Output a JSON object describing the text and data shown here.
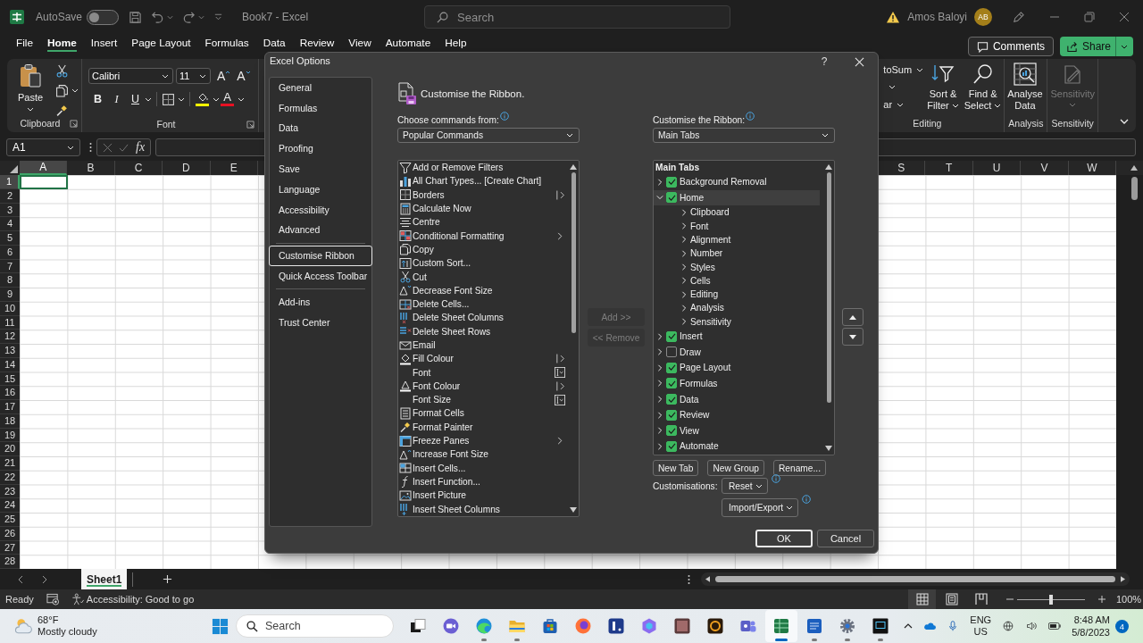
{
  "titlebar": {
    "autosave": {
      "label": "AutoSave",
      "on": false
    },
    "title": "Book7 - Excel",
    "search": {
      "placeholder": "Search"
    },
    "user": "Amos Baloyi",
    "avatar": "AB"
  },
  "menu_tabs": [
    {
      "label": "File",
      "selected": false
    },
    {
      "label": "Home",
      "selected": true
    },
    {
      "label": "Insert",
      "selected": false
    },
    {
      "label": "Page Layout",
      "selected": false
    },
    {
      "label": "Formulas",
      "selected": false
    },
    {
      "label": "Data",
      "selected": false
    },
    {
      "label": "Review",
      "selected": false
    },
    {
      "label": "View",
      "selected": false
    },
    {
      "label": "Automate",
      "selected": false
    },
    {
      "label": "Help",
      "selected": false
    }
  ],
  "header_buttons": {
    "comments": "Comments",
    "share": "Share"
  },
  "ribbon": {
    "clipboard": {
      "paste": "Paste",
      "label": "Clipboard"
    },
    "font": {
      "name": "Calibri",
      "size": "11",
      "label": "Font",
      "size_buttons": [
        {
          "kind": "grow",
          "label": "A"
        },
        {
          "kind": "shrink",
          "label": "A"
        }
      ],
      "style_buttons": [
        {
          "kind": "bold",
          "label": "B"
        },
        {
          "kind": "italic",
          "label": "I"
        },
        {
          "kind": "underline",
          "label": "U"
        }
      ],
      "color_buttons": [
        {
          "kind": "fill",
          "color": "#ffff00"
        },
        {
          "kind": "font",
          "label": "A",
          "color": "#e81123"
        }
      ]
    },
    "editing": {
      "cut_labels": [
        "toSum",
        "ar"
      ],
      "label": "Editing",
      "buttons": [
        {
          "kind": "sort",
          "lines": [
            "Sort &",
            "Filter"
          ],
          "disabled": false
        },
        {
          "kind": "find",
          "lines": [
            "Find &",
            "Select"
          ],
          "disabled": false
        }
      ]
    },
    "analysis": {
      "label": "Analysis",
      "buttons": [
        {
          "kind": "analyse",
          "lines": [
            "Analyse",
            "Data"
          ],
          "disabled": false
        }
      ]
    },
    "sensitivity": {
      "label": "Sensitivity",
      "buttons": [
        {
          "kind": "sensitivity",
          "lines": [
            "Sensitivity"
          ],
          "disabled": true
        }
      ]
    }
  },
  "formula_bar": {
    "name_box": "A1",
    "fx": "fx"
  },
  "sheet": {
    "columns_left": [
      {
        "label": "A",
        "selected": true
      },
      {
        "label": "B",
        "selected": false
      },
      {
        "label": "C",
        "selected": false
      },
      {
        "label": "D",
        "selected": false
      },
      {
        "label": "E",
        "selected": false
      }
    ],
    "columns_right": [
      {
        "label": "S",
        "selected": false
      },
      {
        "label": "T",
        "selected": false
      },
      {
        "label": "U",
        "selected": false
      },
      {
        "label": "V",
        "selected": false
      },
      {
        "label": "W",
        "selected": false
      }
    ],
    "rows": [
      {
        "label": "1",
        "selected": true
      },
      {
        "label": "2",
        "selected": false
      },
      {
        "label": "3",
        "selected": false
      },
      {
        "label": "4",
        "selected": false
      },
      {
        "label": "5",
        "selected": false
      },
      {
        "label": "6",
        "selected": false
      },
      {
        "label": "7",
        "selected": false
      },
      {
        "label": "8",
        "selected": false
      },
      {
        "label": "9",
        "selected": false
      },
      {
        "label": "10",
        "selected": false
      },
      {
        "label": "11",
        "selected": false
      },
      {
        "label": "12",
        "selected": false
      },
      {
        "label": "13",
        "selected": false
      },
      {
        "label": "14",
        "selected": false
      },
      {
        "label": "15",
        "selected": false
      },
      {
        "label": "16",
        "selected": false
      },
      {
        "label": "17",
        "selected": false
      },
      {
        "label": "18",
        "selected": false
      },
      {
        "label": "19",
        "selected": false
      },
      {
        "label": "20",
        "selected": false
      },
      {
        "label": "21",
        "selected": false
      },
      {
        "label": "22",
        "selected": false
      },
      {
        "label": "23",
        "selected": false
      },
      {
        "label": "24",
        "selected": false
      },
      {
        "label": "25",
        "selected": false
      },
      {
        "label": "26",
        "selected": false
      },
      {
        "label": "27",
        "selected": false
      },
      {
        "label": "28",
        "selected": false
      }
    ]
  },
  "sheet_tabs": [
    {
      "label": "Sheet1",
      "selected": true
    }
  ],
  "status_bar": {
    "mode": "Ready",
    "accessibility": "Accessibility: Good to go",
    "views": [
      {
        "kind": "normal",
        "selected": true
      },
      {
        "kind": "layout",
        "selected": false
      },
      {
        "kind": "breaks",
        "selected": false
      }
    ],
    "zoom": {
      "level": 0.5,
      "reading": "100%"
    }
  },
  "dialog": {
    "title": "Excel Options",
    "help": "?",
    "nav": [
      {
        "items": [
          {
            "label": "General",
            "selected": false
          },
          {
            "label": "Formulas",
            "selected": false
          },
          {
            "label": "Data",
            "selected": false
          },
          {
            "label": "Proofing",
            "selected": false
          },
          {
            "label": "Save",
            "selected": false
          },
          {
            "label": "Language",
            "selected": false
          },
          {
            "label": "Accessibility",
            "selected": false
          },
          {
            "label": "Advanced",
            "selected": false
          }
        ]
      },
      {
        "items": [
          {
            "label": "Customise Ribbon",
            "selected": true
          },
          {
            "label": "Quick Access Toolbar",
            "selected": false
          }
        ]
      },
      {
        "items": [
          {
            "label": "Add-ins",
            "selected": false
          },
          {
            "label": "Trust Center",
            "selected": false
          }
        ]
      }
    ],
    "heading": "Customise the Ribbon.",
    "commands": {
      "label": "Choose commands from:",
      "value": "Popular Commands",
      "items": [
        {
          "label": "Add or Remove Filters",
          "kind": "plain",
          "selected": false
        },
        {
          "label": "All Chart Types... [Create Chart]",
          "kind": "plain",
          "selected": false
        },
        {
          "label": "Borders",
          "kind": "split",
          "selected": false
        },
        {
          "label": "Calculate Now",
          "kind": "plain",
          "selected": false
        },
        {
          "label": "Centre",
          "kind": "plain",
          "selected": false
        },
        {
          "label": "Conditional Formatting",
          "kind": "submenu",
          "selected": false
        },
        {
          "label": "Copy",
          "kind": "plain",
          "selected": false
        },
        {
          "label": "Custom Sort...",
          "kind": "plain",
          "selected": false
        },
        {
          "label": "Cut",
          "kind": "plain",
          "selected": false
        },
        {
          "label": "Decrease Font Size",
          "kind": "plain",
          "selected": false
        },
        {
          "label": "Delete Cells...",
          "kind": "plain",
          "selected": false
        },
        {
          "label": "Delete Sheet Columns",
          "kind": "plain",
          "selected": false
        },
        {
          "label": "Delete Sheet Rows",
          "kind": "plain",
          "selected": false
        },
        {
          "label": "Email",
          "kind": "plain",
          "selected": false
        },
        {
          "label": "Fill Colour",
          "kind": "split",
          "selected": false
        },
        {
          "label": "Font",
          "kind": "picker",
          "selected": false
        },
        {
          "label": "Font Colour",
          "kind": "split",
          "selected": false
        },
        {
          "label": "Font Size",
          "kind": "picker",
          "selected": false
        },
        {
          "label": "Format Cells",
          "kind": "plain",
          "selected": false
        },
        {
          "label": "Format Painter",
          "kind": "plain",
          "selected": false
        },
        {
          "label": "Freeze Panes",
          "kind": "submenu",
          "selected": false
        },
        {
          "label": "Increase Font Size",
          "kind": "plain",
          "selected": false
        },
        {
          "label": "Insert Cells...",
          "kind": "plain",
          "selected": false
        },
        {
          "label": "Insert Function...",
          "kind": "plain",
          "selected": false
        },
        {
          "label": "Insert Picture",
          "kind": "plain",
          "selected": false
        },
        {
          "label": "Insert Sheet Columns",
          "kind": "plain",
          "selected": false
        }
      ]
    },
    "move_buttons": [
      {
        "label": "Add >>",
        "disabled": true
      },
      {
        "label": "<< Remove",
        "disabled": true
      }
    ],
    "ribbon_tabs": {
      "label": "Customise the Ribbon:",
      "value": "Main Tabs",
      "title": "Main Tabs",
      "items": [
        {
          "label": "Background Removal",
          "checked": true,
          "expanded": false,
          "selected": false
        },
        {
          "label": "Home",
          "checked": true,
          "expanded": true,
          "selected": true,
          "children": [
            {
              "label": "Clipboard",
              "expanded": false,
              "selected": false
            },
            {
              "label": "Font",
              "expanded": false,
              "selected": false
            },
            {
              "label": "Alignment",
              "expanded": false,
              "selected": false
            },
            {
              "label": "Number",
              "expanded": false,
              "selected": false
            },
            {
              "label": "Styles",
              "expanded": false,
              "selected": false
            },
            {
              "label": "Cells",
              "expanded": false,
              "selected": false
            },
            {
              "label": "Editing",
              "expanded": false,
              "selected": false
            },
            {
              "label": "Analysis",
              "expanded": false,
              "selected": false
            },
            {
              "label": "Sensitivity",
              "expanded": false,
              "selected": false
            }
          ]
        },
        {
          "label": "Insert",
          "checked": true,
          "expanded": false,
          "selected": false
        },
        {
          "label": "Draw",
          "checked": false,
          "expanded": false,
          "selected": false
        },
        {
          "label": "Page Layout",
          "checked": true,
          "expanded": false,
          "selected": false
        },
        {
          "label": "Formulas",
          "checked": true,
          "expanded": false,
          "selected": false
        },
        {
          "label": "Data",
          "checked": true,
          "expanded": false,
          "selected": false
        },
        {
          "label": "Review",
          "checked": true,
          "expanded": false,
          "selected": false
        },
        {
          "label": "View",
          "checked": true,
          "expanded": false,
          "selected": false
        },
        {
          "label": "Automate",
          "checked": true,
          "expanded": false,
          "selected": false
        }
      ]
    },
    "tab_buttons": [
      "New Tab",
      "New Group",
      "Rename..."
    ],
    "customisations": {
      "label": "Customisations:",
      "buttons": [
        "Reset",
        "Import/Export"
      ]
    },
    "footer_buttons": [
      "OK",
      "Cancel"
    ]
  },
  "taskbar": {
    "weather": {
      "temperature": "68°F",
      "condition": "Mostly cloudy"
    },
    "search": {
      "placeholder": "Search"
    },
    "apps": [
      {
        "kind": "taskview",
        "running": false,
        "selected": false
      },
      {
        "kind": "chat",
        "running": false,
        "selected": false
      },
      {
        "kind": "browser",
        "running": true,
        "selected": false
      },
      {
        "kind": "folder",
        "running": true,
        "selected": false
      },
      {
        "kind": "store",
        "running": false,
        "selected": false
      },
      {
        "kind": "fox",
        "running": false,
        "selected": false
      },
      {
        "kind": "tile",
        "running": false,
        "selected": false
      },
      {
        "kind": "copilot",
        "running": false,
        "selected": false
      },
      {
        "kind": "photo",
        "running": false,
        "selected": false
      },
      {
        "kind": "ring",
        "running": false,
        "selected": false
      },
      {
        "kind": "people",
        "running": false,
        "selected": false
      },
      {
        "kind": "sheet",
        "running": true,
        "selected": true
      },
      {
        "kind": "doc",
        "running": true,
        "selected": false
      },
      {
        "kind": "gear",
        "running": true,
        "selected": false
      },
      {
        "kind": "screen",
        "running": true,
        "selected": false
      }
    ],
    "language": [
      "ENG",
      "US"
    ],
    "time": "8:48 AM",
    "date": "5/8/2023",
    "notifications": "4"
  }
}
